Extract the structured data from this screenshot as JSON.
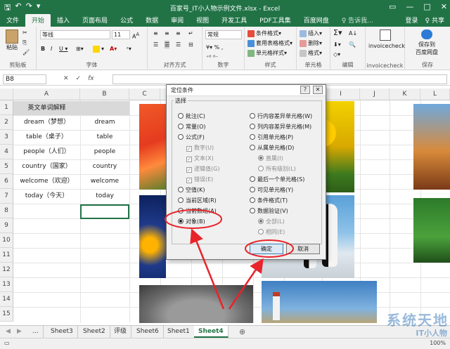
{
  "window": {
    "title": "百家号_IT小人物示例文件.xlsx - Excel",
    "controls": [
      "▭",
      "—",
      "□",
      "✕"
    ]
  },
  "ribbon_tabs": [
    "文件",
    "开始",
    "插入",
    "页面布局",
    "公式",
    "数据",
    "审阅",
    "视图",
    "开发工具",
    "PDF工具集",
    "百度网盘"
  ],
  "tell_me": "♀ 告诉我...",
  "login": "登录",
  "share": "♀ 共享",
  "ribbon": {
    "paste": "粘贴",
    "clipboard": "剪贴板",
    "font_name": "等线",
    "font_size": "11",
    "font_group": "字体",
    "align_group": "对齐方式",
    "number_format": "常规",
    "number_group": "数字",
    "style_items": [
      "条件格式▾",
      "套用表格格式▾",
      "单元格样式▾"
    ],
    "style_group": "样式",
    "cell_items": [
      "插入▾",
      "删除▾",
      "格式▾"
    ],
    "cell_group": "单元格",
    "edit_group": "编辑",
    "invoice_btn": "invoicecheck",
    "invoice_group": "invoicecheck",
    "save_btn_line1": "保存到",
    "save_btn_line2": "百度网盘",
    "save_group": "保存"
  },
  "formula_bar": {
    "name_box": "B8",
    "fx": "fx"
  },
  "columns": [
    "A",
    "B",
    "C",
    "D",
    "E",
    "F",
    "G",
    "H",
    "I",
    "J",
    "K",
    "L"
  ],
  "rows": [
    "1",
    "2",
    "3",
    "4",
    "5",
    "6",
    "7",
    "8",
    "9",
    "10",
    "11",
    "12",
    "13",
    "14",
    "15"
  ],
  "table": {
    "header": "英文单词解释",
    "rows": [
      {
        "a": "dream（梦想）",
        "b": "dream"
      },
      {
        "a": "table（桌子）",
        "b": "table"
      },
      {
        "a": "people（人们）",
        "b": "people"
      },
      {
        "a": "country（国家）",
        "b": "country"
      },
      {
        "a": "welcome（欢迎）",
        "b": "welcome"
      },
      {
        "a": "today（今天）",
        "b": "today"
      }
    ]
  },
  "dialog": {
    "title": "定位条件",
    "help": "?",
    "close": "✕",
    "group_label": "选择",
    "left_options": [
      {
        "label": "批注(C)",
        "kind": "radio",
        "on": false,
        "dis": false
      },
      {
        "label": "常量(O)",
        "kind": "radio",
        "on": false,
        "dis": false
      },
      {
        "label": "公式(F)",
        "kind": "radio",
        "on": false,
        "dis": false
      },
      {
        "label": "数字(U)",
        "kind": "check",
        "on": true,
        "dis": true
      },
      {
        "label": "文本(X)",
        "kind": "check",
        "on": true,
        "dis": true
      },
      {
        "label": "逻辑值(G)",
        "kind": "check",
        "on": true,
        "dis": true
      },
      {
        "label": "错误(E)",
        "kind": "check",
        "on": true,
        "dis": true
      },
      {
        "label": "空值(K)",
        "kind": "radio",
        "on": false,
        "dis": false
      },
      {
        "label": "当前区域(R)",
        "kind": "radio",
        "on": false,
        "dis": false
      },
      {
        "label": "当前数组(A)",
        "kind": "radio",
        "on": false,
        "dis": false
      },
      {
        "label": "对象(B)",
        "kind": "radio",
        "on": true,
        "dis": false
      }
    ],
    "right_options": [
      {
        "label": "行内容差异单元格(W)",
        "kind": "radio",
        "on": false,
        "dis": false
      },
      {
        "label": "列内容差异单元格(M)",
        "kind": "radio",
        "on": false,
        "dis": false
      },
      {
        "label": "引用单元格(P)",
        "kind": "radio",
        "on": false,
        "dis": false
      },
      {
        "label": "从属单元格(D)",
        "kind": "radio",
        "on": false,
        "dis": false
      },
      {
        "label": "直属(I)",
        "kind": "radio",
        "on": true,
        "dis": true
      },
      {
        "label": "所有级别(L)",
        "kind": "radio",
        "on": false,
        "dis": true
      },
      {
        "label": "最后一个单元格(S)",
        "kind": "radio",
        "on": false,
        "dis": false
      },
      {
        "label": "可见单元格(Y)",
        "kind": "radio",
        "on": false,
        "dis": false
      },
      {
        "label": "条件格式(T)",
        "kind": "radio",
        "on": false,
        "dis": false
      },
      {
        "label": "数据验证(V)",
        "kind": "radio",
        "on": false,
        "dis": false
      },
      {
        "label": "全部(L)",
        "kind": "radio",
        "on": true,
        "dis": true
      },
      {
        "label": "相同(E)",
        "kind": "radio",
        "on": false,
        "dis": true
      }
    ],
    "ok": "确定",
    "cancel": "取消"
  },
  "sheet_tabs": [
    "...",
    "Sheet3",
    "Sheet2",
    "评级",
    "Sheet6",
    "Sheet1",
    "Sheet4"
  ],
  "active_sheet": "Sheet4",
  "add_sheet": "⊕",
  "status": {
    "zoom": "100%"
  },
  "watermark": "系统天地",
  "watermark2": "IT小人物",
  "colors": {
    "excel_green": "#217346",
    "annotation_red": "#e8232a"
  }
}
